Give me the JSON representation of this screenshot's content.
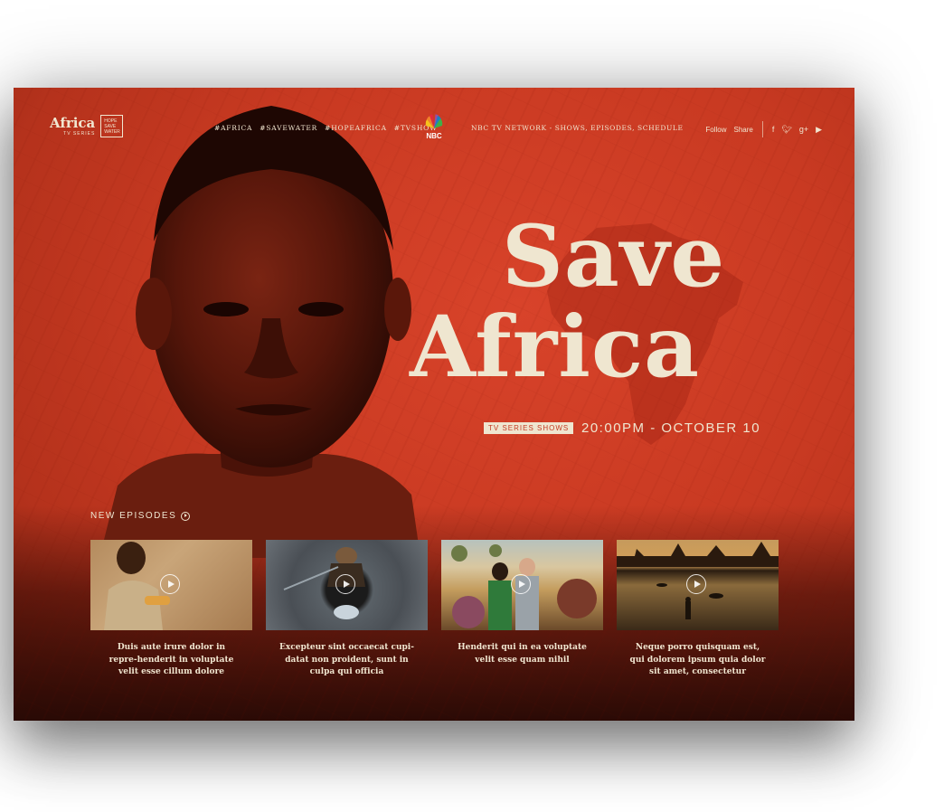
{
  "brand": {
    "title": "Africa",
    "subtitle": "TV SERIES",
    "box_lines": [
      "HOPE",
      "SAVE",
      "WATER"
    ]
  },
  "header": {
    "tags": [
      "#AFRICA",
      "#SAVEWATER",
      "#HOPEAFRICA",
      "#TVSHOW"
    ],
    "network_logo": "NBC",
    "network_link": "NBC TV NETWORK - SHOWS, EPISODES, SCHEDULE",
    "follow": "Follow",
    "share": "Share",
    "social_icons": [
      "facebook-icon",
      "twitter-icon",
      "google-plus-icon",
      "youtube-icon"
    ]
  },
  "hero": {
    "line1": "Save",
    "line2": "Africa",
    "badge": "TV SERIES SHOWS",
    "airtime": "20:00PM - OCTOBER 10"
  },
  "episodes": {
    "heading": "NEW EPISODES",
    "items": [
      {
        "caption": "Duis aute irure dolor in repre-henderit in voluptate velit esse cillum dolore"
      },
      {
        "caption": "Excepteur sint occaecat cupi-datat non proident, sunt in culpa qui officia"
      },
      {
        "caption": "Henderit qui in ea voluptate velit esse quam nihil"
      },
      {
        "caption": "Neque porro quisquam est, qui dolorem ipsum quia dolor sit amet, consectetur"
      }
    ]
  },
  "colors": {
    "accent": "#c93a22",
    "cream": "#efe6d0"
  }
}
